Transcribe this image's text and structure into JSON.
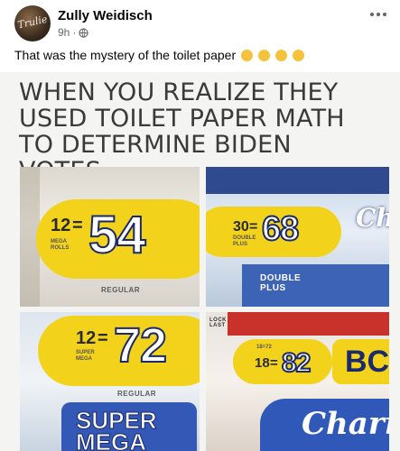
{
  "post": {
    "author": "Zully Weidisch",
    "time": "9h",
    "separator": "·",
    "caption": "That was the mystery of the toilet paper",
    "avatar_text": "Trulie",
    "icons": {
      "privacy": "globe-icon",
      "more": "more-options-icon",
      "reactions": [
        "rolling-laughing-emoji",
        "grinning-sweat-emoji",
        "grinning-emoji",
        "laughing-emoji"
      ]
    }
  },
  "meme": {
    "headline": "WHEN YOU REALIZE THEY USED TOILET PAPER MATH TO DETERMINE BIDEN VOTES.",
    "panels": [
      {
        "small": "12",
        "eq": "=",
        "big": "54",
        "tags": "MEGA ROLLS",
        "type": "REGULAR"
      },
      {
        "small": "30",
        "eq": "=",
        "big": "68",
        "tags": "DOUBLE PLUS",
        "type": "DOUBLE PLUS",
        "brand": "Ch"
      },
      {
        "small": "12",
        "eq": "=",
        "big": "72",
        "tags": "SUPER MEGA",
        "type": "REGULAR",
        "word": "SUPER MEGA"
      },
      {
        "small": "18",
        "eq": "=",
        "big": "82",
        "tags": "18=72",
        "type": "LOCK LAST",
        "brand": "Charr",
        "word": "BC"
      }
    ]
  },
  "colors": {
    "text_primary": "#050505",
    "text_secondary": "#65676b",
    "label_yellow": "#f3d21b",
    "number_outline": "#1a2a6b",
    "headline": "#3a3a3a"
  }
}
